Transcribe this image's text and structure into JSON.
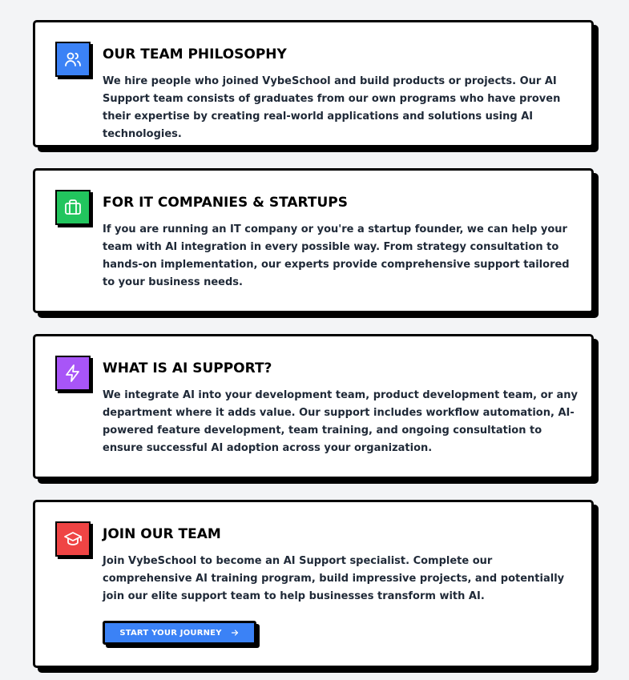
{
  "cards": [
    {
      "icon": "users-icon",
      "color": "#3b82f6",
      "title": "OUR TEAM PHILOSOPHY",
      "text": "We hire people who joined VybeSchool and build products or projects. Our AI Support team consists of graduates from our own programs who have proven their expertise by creating real-world applications and solutions using AI technologies."
    },
    {
      "icon": "briefcase-icon",
      "color": "#22c55e",
      "title": "FOR IT COMPANIES & STARTUPS",
      "text": "If you are running an IT company or you're a startup founder, we can help your team with AI integration in every possible way. From strategy consultation to hands-on implementation, our experts provide comprehensive support tailored to your business needs."
    },
    {
      "icon": "lightning-icon",
      "color": "#a855f7",
      "title": "WHAT IS AI SUPPORT?",
      "text": "We integrate AI into your development team, product development team, or any department where it adds value. Our support includes workflow automation, AI-powered feature development, team training, and ongoing consultation to ensure successful AI adoption across your organization."
    },
    {
      "icon": "graduation-cap-icon",
      "color": "#ef4444",
      "title": "JOIN OUR TEAM",
      "text": "Join VybeSchool to become an AI Support specialist. Complete our comprehensive AI training program, build impressive projects, and potentially join our elite support team to help businesses transform with AI.",
      "button_label": "START YOUR JOURNEY",
      "button_color": "#3b82f6"
    }
  ]
}
